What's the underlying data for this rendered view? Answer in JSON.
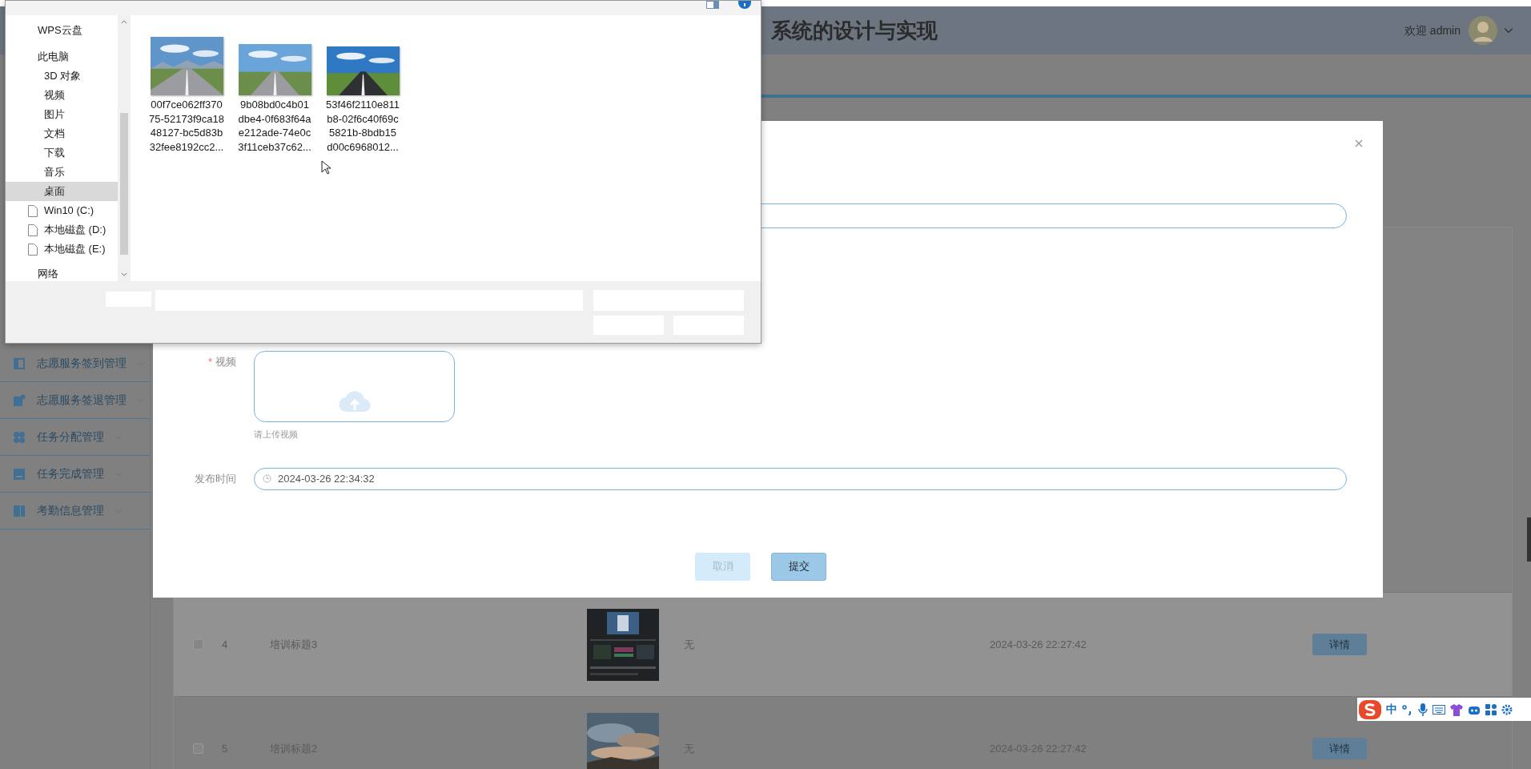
{
  "header": {
    "title": "系统的设计与实现",
    "welcome": "欢迎 admin"
  },
  "sidebar": {
    "items": [
      {
        "label": "志愿服务签到管理",
        "expanded": false
      },
      {
        "label": "志愿服务签退管理",
        "expanded": false
      },
      {
        "label": "任务分配管理",
        "expanded": false
      },
      {
        "label": "任务完成管理",
        "expanded": false
      },
      {
        "label": "考勤信息管理",
        "expanded": false
      }
    ]
  },
  "table": {
    "rows": [
      {
        "checked": false,
        "hovered": true,
        "index": "4",
        "title": "培训标题3",
        "remark": "无",
        "time": "2024-03-26 22:27:42",
        "action": "详情"
      },
      {
        "checked": false,
        "hovered": false,
        "index": "5",
        "title": "培训标题2",
        "remark": "无",
        "time": "2024-03-26 22:27:42",
        "action": "详情"
      }
    ]
  },
  "modal": {
    "video": {
      "label": "视频",
      "required_mark": "*",
      "hint": "请上传视频"
    },
    "publish_time": {
      "label": "发布时间",
      "value": "2024-03-26 22:34:32"
    },
    "buttons": [
      {
        "label": "取消",
        "kind": "cancel"
      },
      {
        "label": "提交",
        "kind": "submit"
      }
    ]
  },
  "file_dialog": {
    "nav": [
      {
        "label": "WPS云盘",
        "selected": false
      },
      {
        "label": "此电脑",
        "selected": false,
        "children": [
          {
            "label": "3D 对象",
            "selected": false,
            "kind": "folder"
          },
          {
            "label": "视频",
            "selected": false,
            "kind": "folder"
          },
          {
            "label": "图片",
            "selected": false,
            "kind": "folder"
          },
          {
            "label": "文档",
            "selected": false,
            "kind": "folder"
          },
          {
            "label": "下载",
            "selected": false,
            "kind": "folder"
          },
          {
            "label": "音乐",
            "selected": false,
            "kind": "folder"
          },
          {
            "label": "桌面",
            "selected": true,
            "kind": "folder"
          },
          {
            "label": "Win10 (C:)",
            "selected": false,
            "kind": "drive"
          },
          {
            "label": "本地磁盘 (D:)",
            "selected": false,
            "kind": "drive"
          },
          {
            "label": "本地磁盘 (E:)",
            "selected": false,
            "kind": "drive"
          }
        ]
      },
      {
        "label": "网络",
        "selected": false
      }
    ],
    "files": [
      {
        "name_lines": [
          "00f7ce062ff370",
          "75-52173f9ca18",
          "48127-bc5d83b",
          "32fee8192cc2..."
        ]
      },
      {
        "name_lines": [
          "9b08bd0c4b01",
          "dbe4-0f683f64a",
          "e212ade-74e0c",
          "3f11ceb37c62..."
        ]
      },
      {
        "name_lines": [
          "53f46f2110e811",
          "b8-02f6c40f69c",
          "5821b-8bdb15",
          "d00c6968012..."
        ]
      }
    ]
  },
  "ime": {
    "mode": "中"
  }
}
